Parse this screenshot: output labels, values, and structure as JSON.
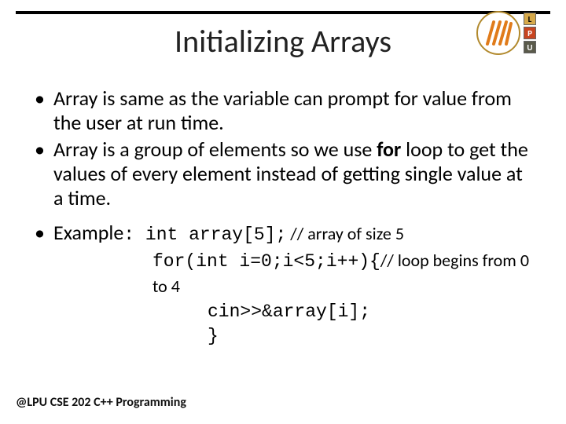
{
  "title": "Initializing Arrays",
  "logo": {
    "letters": [
      "L",
      "P",
      "U"
    ]
  },
  "bullets": {
    "b1": "Array is same as the variable can prompt for value from the user at run time.",
    "b2a": "Array is a group of elements so we use ",
    "b2b": "for",
    "b2c": " loop to get the values of every element instead of getting single value at a time.",
    "b3a": "Example",
    "b3b": ": ",
    "b3code": "int array[5];",
    "b3comment": " // array of size 5"
  },
  "code": {
    "l1a": "for(int i=0;i<5;i++){",
    "l1b": "// loop begins from 0 to 4",
    "l2": "cin>>&array[i];",
    "l3": "}"
  },
  "footer": "@LPU CSE 202 C++ Programming"
}
